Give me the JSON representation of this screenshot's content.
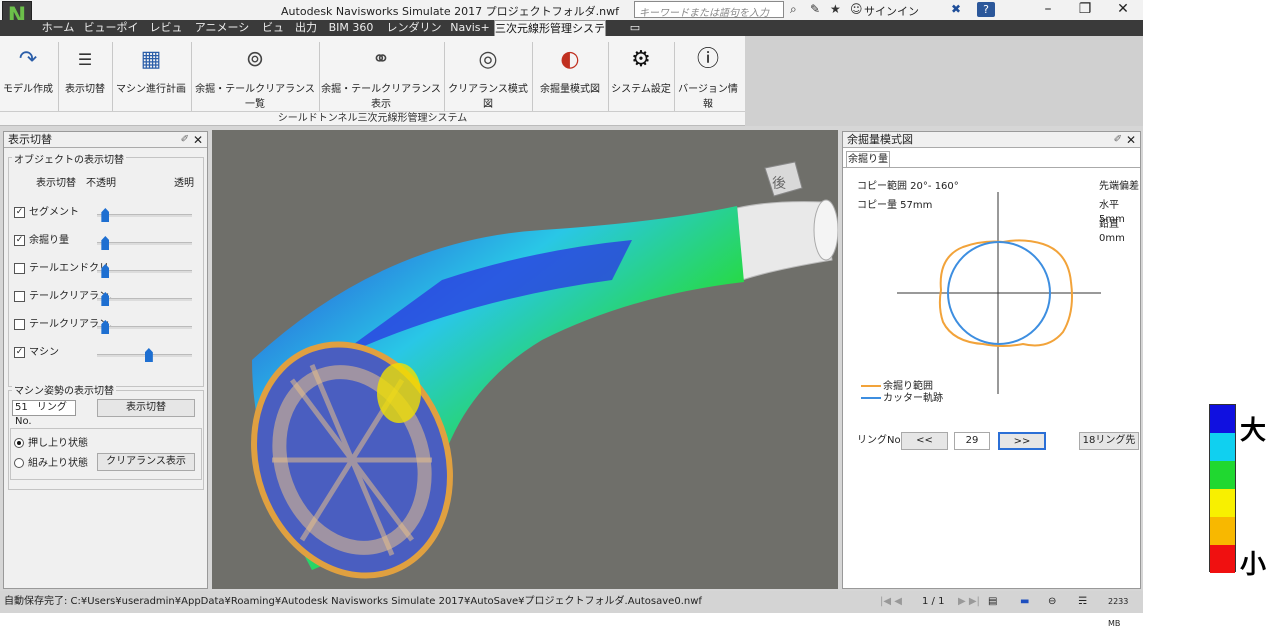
{
  "window": {
    "title": "Autodesk Navisworks Simulate 2017    プロジェクトフォルダ.nwf",
    "search_placeholder": "キーワードまたは語句を入力",
    "signin": "サインイン",
    "app_logo": "N"
  },
  "tabs": [
    "ホーム",
    "ビューポイント",
    "レビュー",
    "アニメーション",
    "ビュー",
    "出力",
    "BIM 360",
    "レンダリング",
    "Navis+",
    "三次元線形管理システム"
  ],
  "ribbon": {
    "buttons": [
      "モデル作成",
      "表示切替",
      "マシン進行計画",
      "余掘・テールクリアランス一覧",
      "余掘・テールクリアランス表示",
      "クリアランス模式図",
      "余掘量模式図",
      "システム設定",
      "バージョン情報"
    ],
    "group_label": "シールドトンネル三次元線形管理システム"
  },
  "left_panel": {
    "title": "表示切替",
    "object_group": "オブジェクトの表示切替",
    "col_toggle": "表示切替",
    "col_opaque": "不透明",
    "col_transparent": "透明",
    "rows": [
      {
        "label": "セグメント",
        "checked": true,
        "level": 0.05
      },
      {
        "label": "余掘り量",
        "checked": true,
        "level": 0.05
      },
      {
        "label": "テールエンドクリ",
        "checked": false,
        "level": 0.05
      },
      {
        "label": "テールクリアラン.",
        "checked": false,
        "level": 0.05
      },
      {
        "label": "テールクリアラン.",
        "checked": false,
        "level": 0.05
      },
      {
        "label": "マシン",
        "checked": true,
        "level": 0.55
      }
    ],
    "machine_group": "マシン姿勢の表示切替",
    "ring_value": "51",
    "ring_label": "リングNo.",
    "toggle_button": "表示切替",
    "radio_push": "押し上り状態",
    "radio_assembled": "組み上り状態",
    "clearance_button": "クリアランス表示"
  },
  "right_panel": {
    "title": "余掘量模式図",
    "tab": "余掘り量",
    "copy_range": "コピー範囲 20°- 160°",
    "copy_amount": "コピー量 57mm",
    "tip_offset": "先端偏差",
    "horizontal": "水平 5mm",
    "vertical": "鉛直 0mm",
    "legend_overcut": "余掘り範囲",
    "legend_cutter": "カッター軌跡",
    "ring_label": "リングNo.",
    "prev": "<<",
    "ring_value": "29",
    "next": ">>",
    "ahead": "18リング先",
    "color_overcut": "#f2a33a",
    "color_cutter": "#3d8ee0"
  },
  "viewcube_label": "後",
  "status": {
    "text": "自動保存完了: C:¥Users¥useradmin¥AppData¥Roaming¥Autodesk Navisworks Simulate 2017¥AutoSave¥プロジェクトフォルダ.Autosave0.nwf",
    "page": "1 / 1",
    "memory": "2233 MB"
  },
  "legend": {
    "high": "大",
    "low": "小",
    "colors": [
      "#1010e0",
      "#10d0f0",
      "#20d830",
      "#f8f000",
      "#f8b800",
      "#f01010"
    ]
  }
}
